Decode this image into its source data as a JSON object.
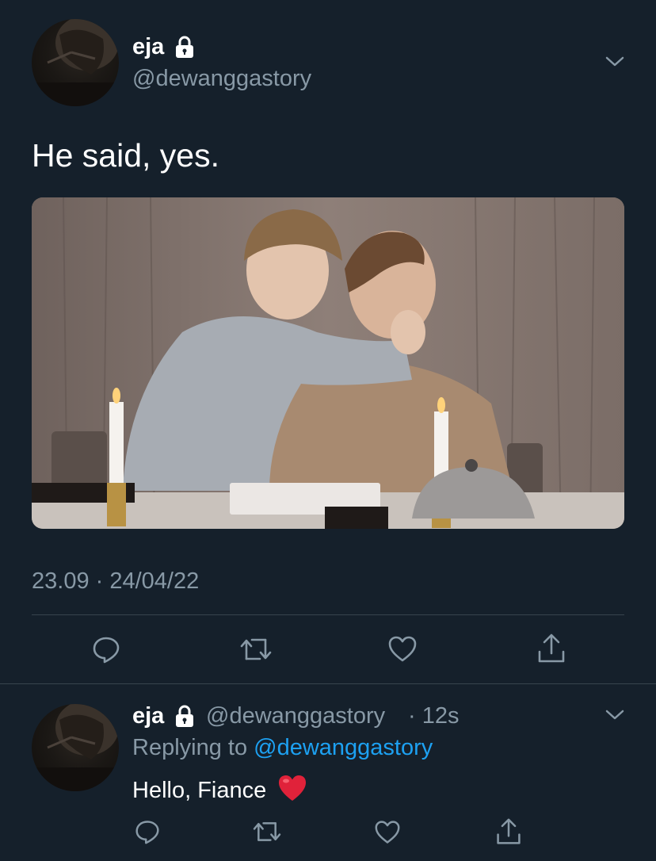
{
  "tweet": {
    "author_name": "eja",
    "author_handle": "@dewanggastory",
    "text": "He said, yes.",
    "timestamp": "23.09 · 24/04/22"
  },
  "reply": {
    "author_name": "eja",
    "author_handle": "@dewanggastory",
    "time": "· 12s",
    "replying_prefix": "Replying to",
    "replying_handle": "@dewanggastory",
    "text": "Hello, Fiance"
  },
  "icons": {
    "lock": "lock-icon",
    "chevron": "chevron-down-icon",
    "reply": "reply-icon",
    "retweet": "retweet-icon",
    "like": "heart-icon",
    "share": "share-icon",
    "emoji": "red-heart-emoji"
  },
  "colors": {
    "background": "#15202b",
    "muted_text": "#8899a6",
    "link": "#1da1f2",
    "divider": "#38444d",
    "emoji_heart": "#e0223a"
  }
}
